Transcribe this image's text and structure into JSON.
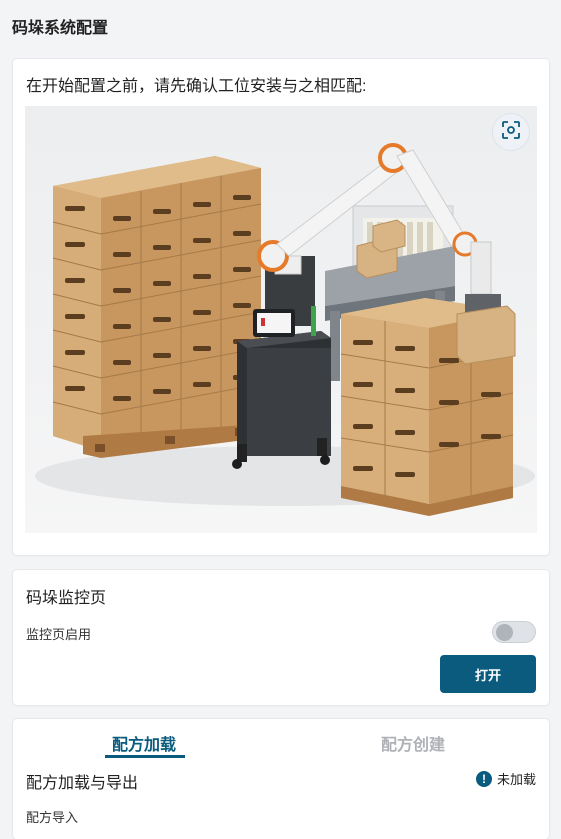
{
  "page": {
    "title": "码垛系统配置"
  },
  "intro": {
    "text": "在开始配置之前，请先确认工位安装与之相匹配:",
    "illustration_icon": "palletizing-workstation-illustration",
    "focus_icon": "focus-scan-icon"
  },
  "monitor": {
    "title": "码垛监控页",
    "enable_label": "监控页启用",
    "enabled": false,
    "open_label": "打开"
  },
  "recipe": {
    "tabs": [
      {
        "label": "配方加载",
        "active": true
      },
      {
        "label": "配方创建",
        "active": false
      }
    ],
    "section_title": "配方加载与导出",
    "status_text": "未加载",
    "status_icon": "info-icon",
    "import_label": "配方导入"
  },
  "colors": {
    "accent": "#0a5b7d",
    "background": "#f3f4f6",
    "card": "#ffffff",
    "inactive_tab": "#aeb2b7"
  }
}
